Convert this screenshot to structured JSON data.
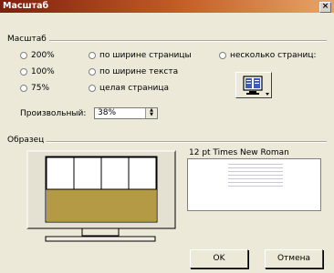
{
  "window": {
    "title": "Масштаб",
    "close_glyph": "×"
  },
  "zoom_group": {
    "label": "Масштаб",
    "options": [
      {
        "label": "200%",
        "selected": false
      },
      {
        "label": "100%",
        "selected": false
      },
      {
        "label": "75%",
        "selected": false
      },
      {
        "label": "по ширине страницы",
        "selected": false
      },
      {
        "label": "по ширине текста",
        "selected": false
      },
      {
        "label": "целая страница",
        "selected": false
      },
      {
        "label": "несколько страниц:",
        "selected": false
      }
    ],
    "custom": {
      "label": "Произвольный:",
      "value": "38%"
    },
    "pages_button_icon": "monitor-pages-icon"
  },
  "sample_group": {
    "label": "Образец",
    "font_caption": "12 pt Times New Roman"
  },
  "buttons": {
    "ok": "OK",
    "cancel": "Отмена"
  }
}
